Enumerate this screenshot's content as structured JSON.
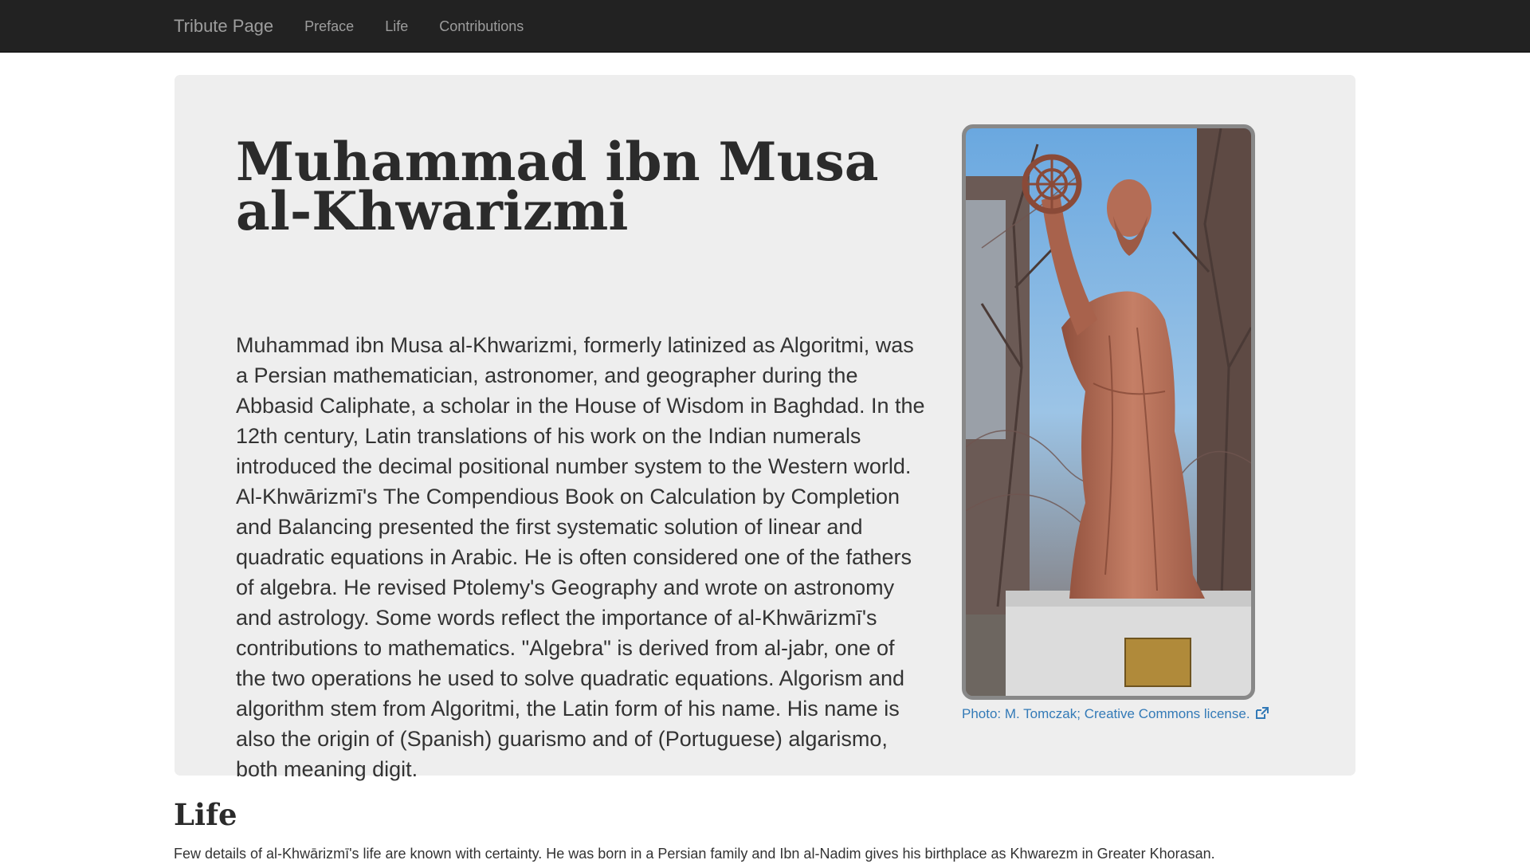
{
  "navbar": {
    "brand": "Tribute Page",
    "links": [
      "Preface",
      "Life",
      "Contributions"
    ]
  },
  "hero": {
    "title": "Muhammad ibn Musa al-Khwarizmi",
    "text": "Muhammad ibn Musa al-Khwarizmi, formerly latinized as Algoritmi, was a Persian mathematician, astronomer, and geographer during the Abbasid Caliphate, a scholar in the House of Wisdom in Baghdad. In the 12th century, Latin translations of his work on the Indian numerals introduced the decimal positional number system to the Western world. Al-Khwārizmī's The Compendious Book on Calculation by Completion and Balancing presented the first systematic solution of linear and quadratic equations in Arabic. He is often considered one of the fathers of algebra. He revised Ptolemy's Geography and wrote on astronomy and astrology. Some words reflect the importance of al-Khwārizmī's contributions to mathematics. \"Algebra\" is derived from al-jabr, one of the two operations he used to solve quadratic equations. Algorism and algorithm stem from Algoritmi, the Latin form of his name. His name is also the origin of (Spanish) guarismo and of (Portuguese) algarismo, both meaning digit.",
    "photo_caption": "Photo: M. Tomczak; Creative Commons license.",
    "photo_icon": "external-link-icon"
  },
  "life": {
    "title": "Life",
    "text": "Few details of al-Khwārizmī's life are known with certainty. He was born in a Persian family and Ibn al-Nadim gives his birthplace as Khwarezm in Greater Khorasan."
  },
  "colors": {
    "navbar_bg": "#222222",
    "navbar_text": "#9d9d9d",
    "jumbotron_bg": "#eeeeee",
    "link": "#337ab7",
    "statue": "#b9725c"
  }
}
